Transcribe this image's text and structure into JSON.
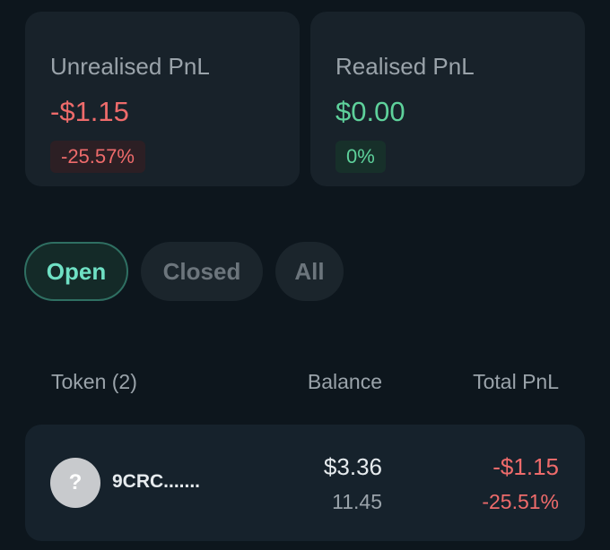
{
  "summary": {
    "unrealised": {
      "label": "Unrealised PnL",
      "amount": "-$1.15",
      "percent": "-25.57%"
    },
    "realised": {
      "label": "Realised PnL",
      "amount": "$0.00",
      "percent": "0%"
    }
  },
  "tabs": [
    {
      "label": "Open",
      "active": true
    },
    {
      "label": "Closed",
      "active": false
    },
    {
      "label": "All",
      "active": false
    }
  ],
  "table": {
    "headers": {
      "token": "Token (2)",
      "balance": "Balance",
      "total_pnl": "Total PnL"
    },
    "rows": [
      {
        "icon": "question-mark-icon",
        "icon_glyph": "?",
        "token": "9CRC.......",
        "balance_usd": "$3.36",
        "balance_amount": "11.45",
        "pnl_usd": "-$1.15",
        "pnl_percent": "-25.51%"
      }
    ]
  },
  "colors": {
    "negative": "#ee6b6b",
    "positive": "#5ed19b",
    "active_tab": "#6fe0c4",
    "background": "#0d161d",
    "card": "#18222a"
  }
}
